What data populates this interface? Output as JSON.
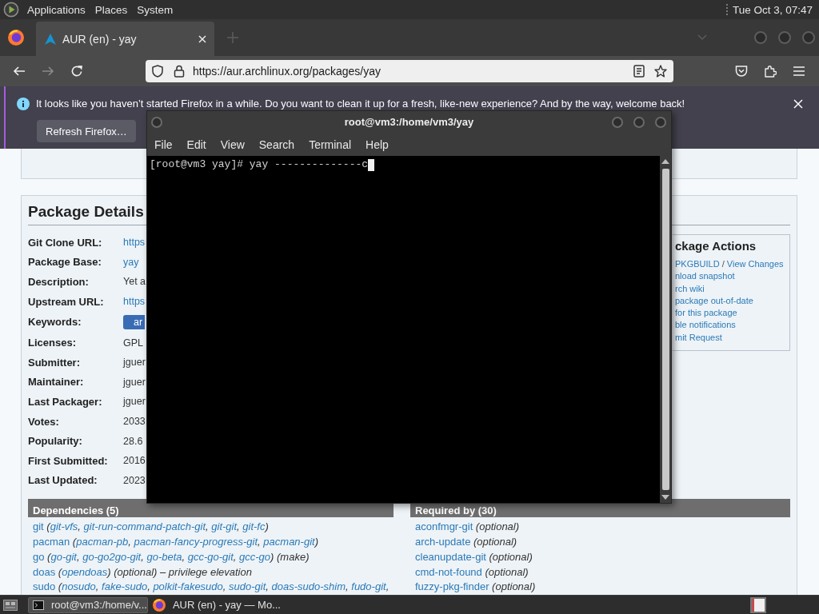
{
  "top_panel": {
    "menus": [
      "Applications",
      "Places",
      "System"
    ],
    "clock": "Tue Oct 3, 07:47"
  },
  "browser": {
    "tabs": [
      {
        "title": "AUR (en) - yay",
        "selected": true
      }
    ],
    "address": "https://aur.archlinux.org/packages/yay",
    "notification": {
      "message": "It looks like you haven’t started Firefox in a while. Do you want to clean it up for a fresh, like-new experience? And by the way, welcome back!",
      "button": "Refresh Firefox…"
    },
    "page": {
      "details": {
        "heading": "Package Details",
        "rows": [
          {
            "label": "Git Clone URL:",
            "value": "https",
            "kind": "link"
          },
          {
            "label": "Package Base:",
            "value": "yay",
            "kind": "link"
          },
          {
            "label": "Description:",
            "value": "Yet a",
            "kind": "text"
          },
          {
            "label": "Upstream URL:",
            "value": "https",
            "kind": "link"
          },
          {
            "label": "Keywords:",
            "value": "ar",
            "kind": "keyword"
          },
          {
            "label": "Licenses:",
            "value": "GPL",
            "kind": "text"
          },
          {
            "label": "Submitter:",
            "value": "jguer",
            "kind": "text"
          },
          {
            "label": "Maintainer:",
            "value": "jguer",
            "kind": "text"
          },
          {
            "label": "Last Packager:",
            "value": "jguer",
            "kind": "text"
          },
          {
            "label": "Votes:",
            "value": "2033",
            "kind": "text"
          },
          {
            "label": "Popularity:",
            "value": "28.6",
            "kind": "text"
          },
          {
            "label": "First Submitted:",
            "value": "2016",
            "kind": "text"
          },
          {
            "label": "Last Updated:",
            "value": "2023",
            "kind": "text"
          }
        ]
      },
      "actions": {
        "heading": "ckage Actions",
        "lines": [
          [
            {
              "kind": "link",
              "text": "PKGBUILD"
            },
            {
              "kind": "text",
              "text": " / "
            },
            {
              "kind": "link",
              "text": "View Changes"
            }
          ],
          [
            {
              "kind": "link",
              "text": "nload snapshot"
            }
          ],
          [
            {
              "kind": "link",
              "text": "rch wiki"
            }
          ],
          [
            {
              "kind": "link",
              "text": "package out-of-date"
            }
          ],
          [
            {
              "kind": "link",
              "text": "for this package"
            }
          ],
          [
            {
              "kind": "link",
              "text": "ble notifications"
            }
          ],
          [
            {
              "kind": "link",
              "text": "mit Request"
            }
          ]
        ]
      },
      "dependencies": {
        "heading": "Dependencies (5)",
        "lines": [
          [
            {
              "kind": "link",
              "text": "git"
            },
            {
              "kind": "em",
              "text": " ("
            },
            {
              "kind": "em_link",
              "text": "git-vfs"
            },
            {
              "kind": "em",
              "text": ", "
            },
            {
              "kind": "em_link",
              "text": "git-run-command-patch-git"
            },
            {
              "kind": "em",
              "text": ", "
            },
            {
              "kind": "em_link",
              "text": "git-git"
            },
            {
              "kind": "em",
              "text": ", "
            },
            {
              "kind": "em_link",
              "text": "git-fc"
            },
            {
              "kind": "em",
              "text": ")"
            }
          ],
          [
            {
              "kind": "link",
              "text": "pacman"
            },
            {
              "kind": "em",
              "text": " ("
            },
            {
              "kind": "em_link",
              "text": "pacman-pb"
            },
            {
              "kind": "em",
              "text": ", "
            },
            {
              "kind": "em_link",
              "text": "pacman-fancy-progress-git"
            },
            {
              "kind": "em",
              "text": ", "
            },
            {
              "kind": "em_link",
              "text": "pacman-git"
            },
            {
              "kind": "em",
              "text": ")"
            }
          ],
          [
            {
              "kind": "link",
              "text": "go"
            },
            {
              "kind": "em",
              "text": " ("
            },
            {
              "kind": "em_link",
              "text": "go-git"
            },
            {
              "kind": "em",
              "text": ", "
            },
            {
              "kind": "em_link",
              "text": "go-go2go-git"
            },
            {
              "kind": "em",
              "text": ", "
            },
            {
              "kind": "em_link",
              "text": "go-beta"
            },
            {
              "kind": "em",
              "text": ", "
            },
            {
              "kind": "em_link",
              "text": "gcc-go-git"
            },
            {
              "kind": "em",
              "text": ", "
            },
            {
              "kind": "em_link",
              "text": "gcc-go"
            },
            {
              "kind": "em",
              "text": ") (make)"
            }
          ],
          [
            {
              "kind": "link",
              "text": "doas"
            },
            {
              "kind": "em",
              "text": " ("
            },
            {
              "kind": "em_link",
              "text": "opendoas"
            },
            {
              "kind": "em",
              "text": ") (optional) – privilege elevation"
            }
          ],
          [
            {
              "kind": "link",
              "text": "sudo"
            },
            {
              "kind": "em",
              "text": " ("
            },
            {
              "kind": "em_link",
              "text": "nosudo"
            },
            {
              "kind": "em",
              "text": ", "
            },
            {
              "kind": "em_link",
              "text": "fake-sudo"
            },
            {
              "kind": "em",
              "text": ", "
            },
            {
              "kind": "em_link",
              "text": "polkit-fakesudo"
            },
            {
              "kind": "em",
              "text": ", "
            },
            {
              "kind": "em_link",
              "text": "sudo-git"
            },
            {
              "kind": "em",
              "text": ", "
            },
            {
              "kind": "em_link",
              "text": "doas-sudo-shim"
            },
            {
              "kind": "em",
              "text": ", "
            },
            {
              "kind": "em_link",
              "text": "fudo-git"
            },
            {
              "kind": "em",
              "text": ","
            }
          ]
        ]
      },
      "required_by": {
        "heading": "Required by (30)",
        "lines": [
          [
            {
              "kind": "link",
              "text": "aconfmgr-git"
            },
            {
              "kind": "em",
              "text": " (optional)"
            }
          ],
          [
            {
              "kind": "link",
              "text": "arch-update"
            },
            {
              "kind": "em",
              "text": " (optional)"
            }
          ],
          [
            {
              "kind": "link",
              "text": "cleanupdate-git"
            },
            {
              "kind": "em",
              "text": " (optional)"
            }
          ],
          [
            {
              "kind": "link",
              "text": "cmd-not-found"
            },
            {
              "kind": "em",
              "text": " (optional)"
            }
          ],
          [
            {
              "kind": "link",
              "text": "fuzzy-pkg-finder"
            },
            {
              "kind": "em",
              "text": " (optional)"
            }
          ]
        ]
      }
    }
  },
  "terminal": {
    "title": "root@vm3:/home/vm3/yay",
    "menu": [
      "File",
      "Edit",
      "View",
      "Search",
      "Terminal",
      "Help"
    ],
    "lines": [
      "[root@vm3 yay]# yay --------------c"
    ]
  },
  "taskbar": {
    "tasks": [
      {
        "label": "root@vm3:/home/v...",
        "kind": "terminal",
        "selected": true
      },
      {
        "label": "AUR (en) - yay — Mo...",
        "kind": "browser",
        "selected": false
      }
    ]
  }
}
